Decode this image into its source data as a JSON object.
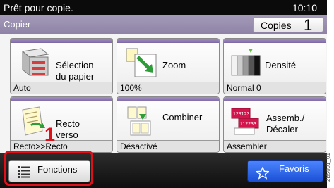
{
  "status_bar": {
    "message": "Prêt pour copie.",
    "time": "10:10"
  },
  "header": {
    "title": "Copier",
    "copies_label": "Copies",
    "copies_value": "1"
  },
  "tiles": [
    {
      "label_line1": "Sélection",
      "label_line2": "du papier",
      "value": "Auto",
      "icon": "paper-tray-icon"
    },
    {
      "label_line1": "Zoom",
      "label_line2": "",
      "value": "100%",
      "icon": "zoom-icon"
    },
    {
      "label_line1": "Densité",
      "label_line2": "",
      "value": "Normal 0",
      "icon": "density-icon"
    },
    {
      "label_line1": "Recto",
      "label_line2": "verso",
      "value": "Recto>>Recto",
      "icon": "duplex-icon"
    },
    {
      "label_line1": "Combiner",
      "label_line2": "",
      "value": "Désactivé",
      "icon": "combine-icon"
    },
    {
      "label_line1": "Assemb./",
      "label_line2": "Décaler",
      "value": "Assembler",
      "icon": "collate-icon",
      "icon_text": [
        "123123",
        "112233"
      ]
    }
  ],
  "footer": {
    "functions_label": "Fonctions",
    "favorites_label": "Favoris"
  },
  "annotation": {
    "step": "1"
  },
  "side_code": "2B5001_01",
  "colors": {
    "accent": "#7c68a4",
    "header": "#9a8fb0",
    "callout": "#e0101a",
    "favorites": "#2a5ff0"
  }
}
